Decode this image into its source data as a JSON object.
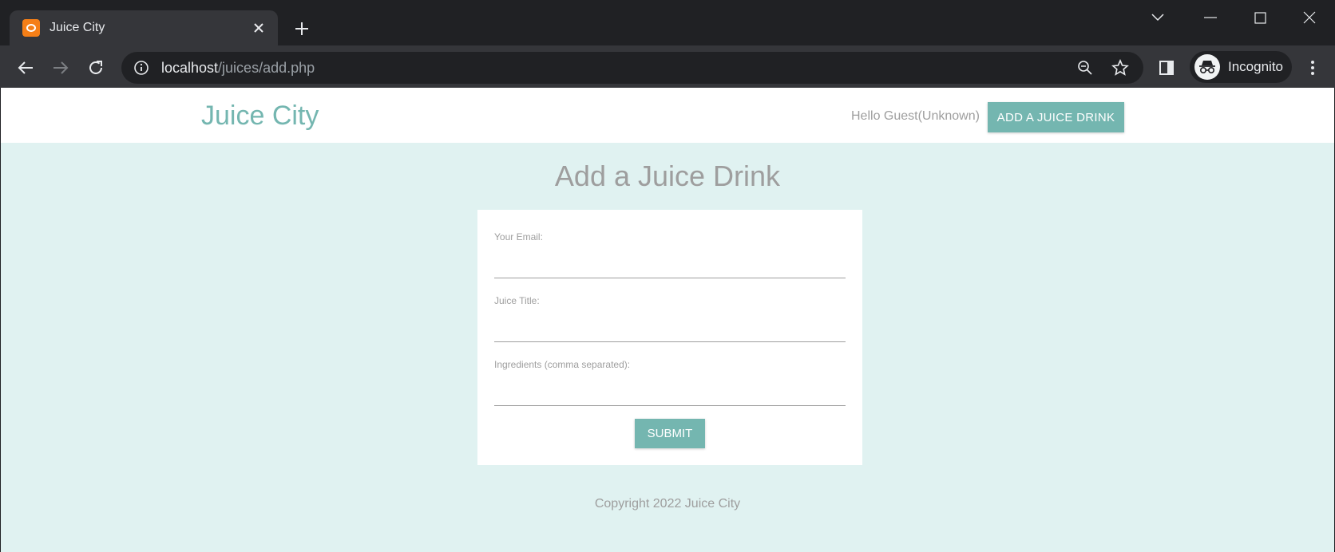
{
  "browser": {
    "tab_title": "Juice City",
    "url_host": "localhost",
    "url_path": "/juices/add.php",
    "profile_label": "Incognito"
  },
  "site": {
    "brand": "Juice City",
    "greeting": "Hello Guest(Unknown)",
    "add_button": "ADD A JUICE DRINK"
  },
  "main": {
    "title": "Add a Juice Drink",
    "form": {
      "email_label": "Your Email:",
      "email_value": "",
      "title_label": "Juice Title:",
      "title_value": "",
      "ingredients_label": "Ingredients (comma separated):",
      "ingredients_value": "",
      "submit_label": "SUBMIT"
    }
  },
  "footer": {
    "copyright": "Copyright 2022 Juice City"
  },
  "colors": {
    "accent": "#74b6b0",
    "page_bg": "#e0f2f1",
    "muted_text": "#9e9e9e"
  }
}
